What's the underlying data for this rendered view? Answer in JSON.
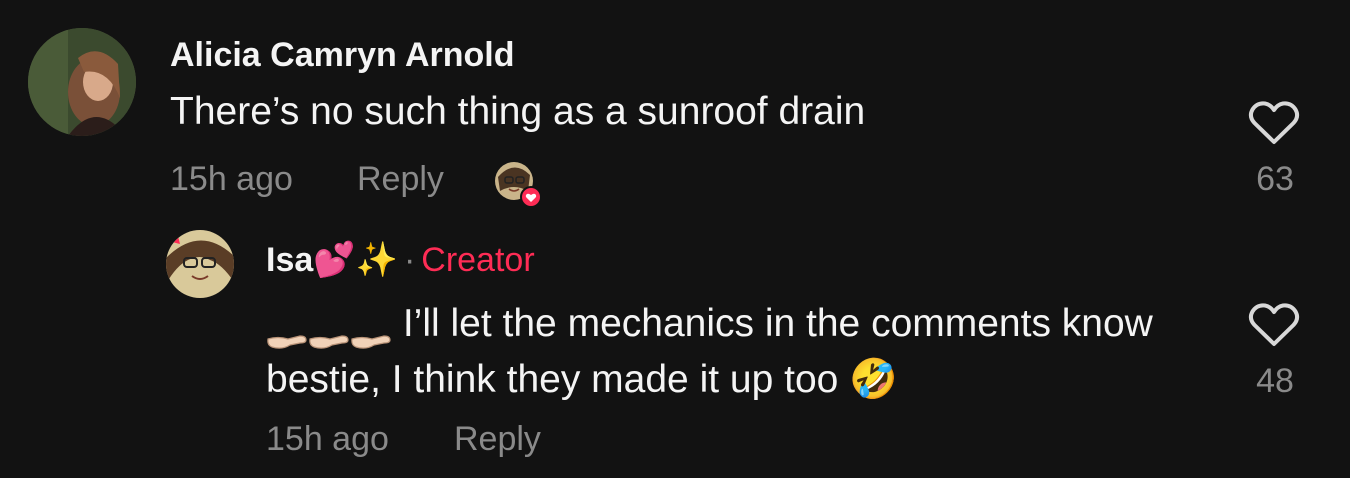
{
  "comment": {
    "author": "Alicia Camryn Arnold",
    "text": "There’s no such thing as a sunroof drain",
    "time": "15h ago",
    "reply_label": "Reply",
    "like_count": "63",
    "avatar_icon": "user-avatar-photo",
    "liked_by_creator_icon": "creator-liked-avatar"
  },
  "reply": {
    "author": "Isa",
    "author_emoji": "💕✨",
    "separator": "·",
    "badge": "Creator",
    "text": "I’ll let the mechanics in the comments know bestie, I think they made it up too",
    "trailing_emoji": "🤣",
    "leading_emoji_icons": [
      "pinching-hand-icon",
      "pinching-hand-icon",
      "pinching-hand-icon"
    ],
    "time": "15h ago",
    "reply_label": "Reply",
    "like_count": "48"
  },
  "colors": {
    "background": "#121212",
    "text_primary": "#f4f4f4",
    "text_secondary": "#8a8a8a",
    "creator_accent": "#fe2c55",
    "heart_outline": "#d8d8d8"
  }
}
